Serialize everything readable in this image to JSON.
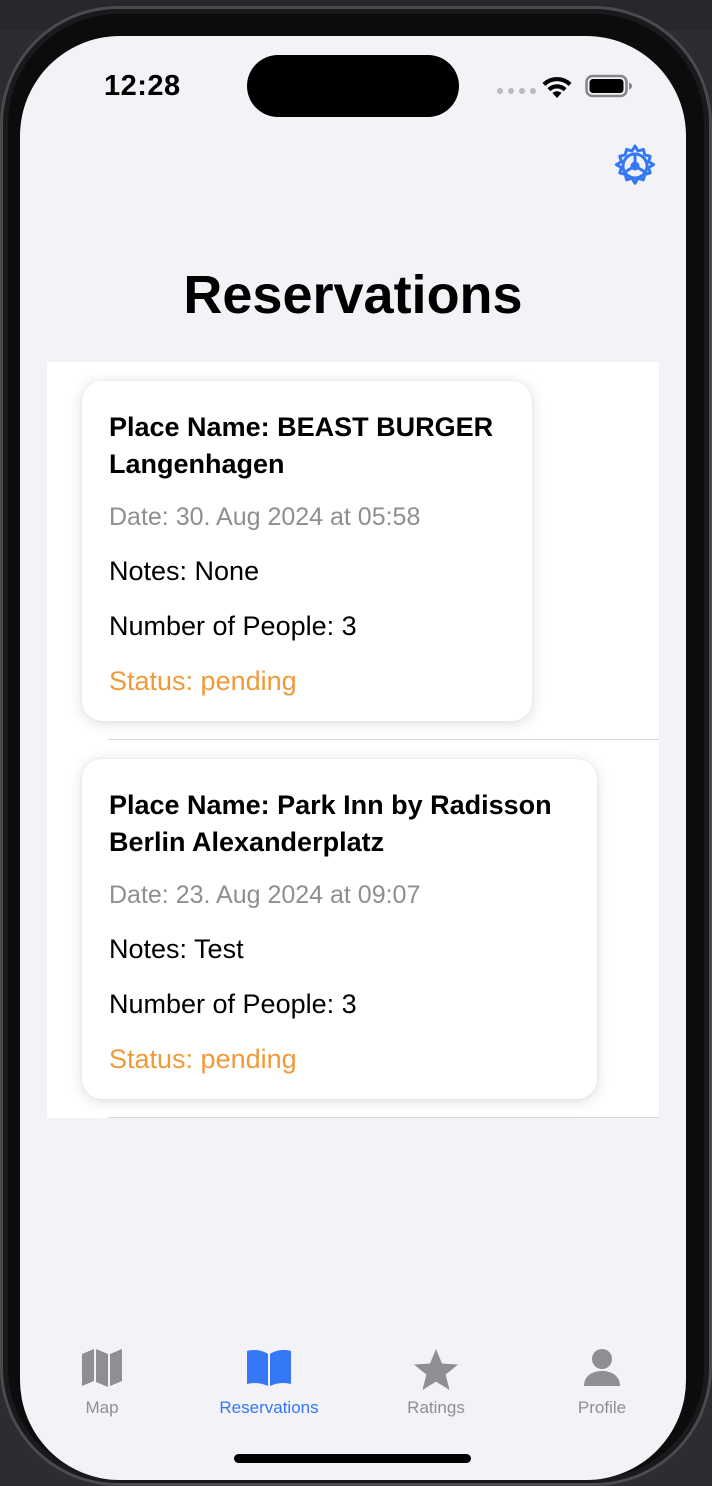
{
  "status_bar": {
    "time": "12:28"
  },
  "header": {
    "title": "Reservations",
    "settings_icon": "gear-icon"
  },
  "reservations": [
    {
      "place_line1": "Place Name: BEAST BURGER",
      "place_line2": "Langenhagen",
      "date": "Date: 30. Aug 2024 at 05:58",
      "notes": "Notes: None",
      "people": "Number of People: 3",
      "status": "Status: pending"
    },
    {
      "place_line1": "Place Name: Park Inn by Radisson",
      "place_line2": "Berlin Alexanderplatz",
      "date": "Date: 23. Aug 2024 at 09:07",
      "notes": "Notes: Test",
      "people": "Number of People: 3",
      "status": "Status: pending"
    }
  ],
  "tab_bar": {
    "items": [
      {
        "label": "Map",
        "icon": "map-icon",
        "active": false
      },
      {
        "label": "Reservations",
        "icon": "book-icon",
        "active": true
      },
      {
        "label": "Ratings",
        "icon": "star-icon",
        "active": false
      },
      {
        "label": "Profile",
        "icon": "person-icon",
        "active": false
      }
    ]
  },
  "colors": {
    "accent": "#3478f6",
    "status_pending": "#f09a37",
    "secondary_text": "#8e8e93",
    "background": "#f2f2f7"
  }
}
